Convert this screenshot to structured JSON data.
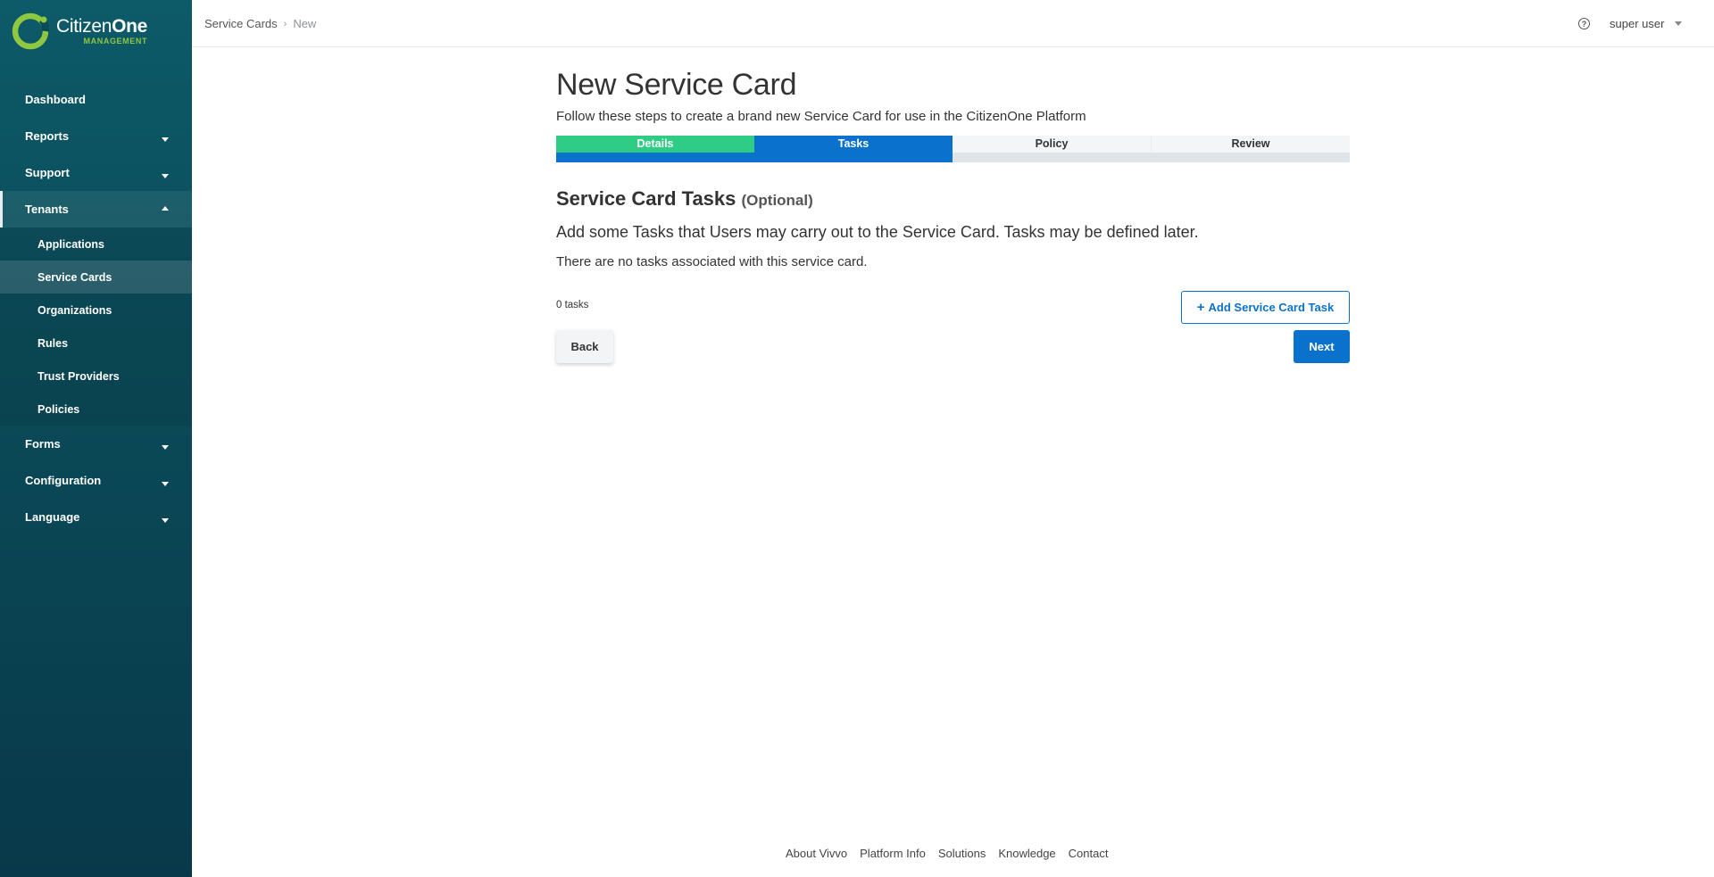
{
  "brand": {
    "name_bold": "Citizen",
    "name_light": "One",
    "tagline": "MANAGEMENT",
    "accent": "#8fc740"
  },
  "sidebar": {
    "items": [
      {
        "label": "Dashboard",
        "has_caret": false
      },
      {
        "label": "Reports",
        "has_caret": true
      },
      {
        "label": "Support",
        "has_caret": true
      },
      {
        "label": "Tenants",
        "has_caret": true,
        "expanded": true
      },
      {
        "label": "Forms",
        "has_caret": true
      },
      {
        "label": "Configuration",
        "has_caret": true
      },
      {
        "label": "Language",
        "has_caret": true
      }
    ],
    "tenants_sub": [
      {
        "label": "Applications"
      },
      {
        "label": "Service Cards",
        "active": true
      },
      {
        "label": "Organizations"
      },
      {
        "label": "Rules"
      },
      {
        "label": "Trust Providers"
      },
      {
        "label": "Policies"
      }
    ]
  },
  "topbar": {
    "breadcrumb": {
      "parent": "Service Cards",
      "current": "New"
    },
    "help_icon": "question-circle-icon",
    "user": "super user"
  },
  "main": {
    "title": "New Service Card",
    "subtitle": "Follow these steps to create a brand new Service Card for use in the CitizenOne Platform",
    "steps": [
      "Details",
      "Tasks",
      "Policy",
      "Review"
    ],
    "current_step": 2,
    "progress_fraction": 0.5,
    "section_title": "Service Card Tasks",
    "section_optional": "(Optional)",
    "lead": "Add some Tasks that Users may carry out to the Service Card. Tasks may be defined later.",
    "empty_message": "There are no tasks associated with this service card.",
    "task_count": "0 tasks",
    "add_task_label": "Add Service Card Task",
    "back_label": "Back",
    "next_label": "Next"
  },
  "footer": {
    "links": [
      "About Vivvo",
      "Platform Info",
      "Solutions",
      "Knowledge",
      "Contact"
    ]
  },
  "colors": {
    "primary": "#0a72cc",
    "success": "#2ecc85",
    "sidebar": "#0b4a58"
  }
}
